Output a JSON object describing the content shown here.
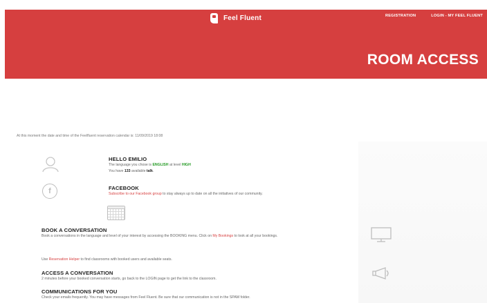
{
  "header": {
    "brand": "Feel Fluent",
    "nav": [
      "REGISTRATION",
      "LOGIN - MY FEEL FLUENT"
    ],
    "title": "ROOM ACCESS",
    "color": "#d63f3f"
  },
  "timestamp": "At this moment the date and time of the Feelfluent reservation calendar is: 11/09/2019 18:08",
  "hello": {
    "title": "HELLO EMILIO",
    "language_prefix": "The language you chose is ",
    "language": "ENGLISH",
    "level_mid": " at level ",
    "level": "HIGH",
    "talk_prefix": "You have ",
    "talk_count": "133",
    "talk_mid": " available ",
    "talk_suffix": "talk",
    "talk_end": "."
  },
  "facebook": {
    "title": "FACEBOOK",
    "link": "Subscribe to our Facebook group",
    "text": " to stay always up to date on all the initiatives of our community."
  },
  "booking": {
    "title": "BOOK A CONVERSATION",
    "text_before": "Book a conversations in the language and level of your interest by accessing the BOOKING menu. Click on ",
    "link": "My Bookings",
    "text_after": " to look at all your bookings.",
    "helper_link": "Reservation Helper",
    "helper_text": " to find classrooms with booked users and available seats.",
    "helper_prefix": "Use "
  },
  "access": {
    "title": "ACCESS A CONVERSATION",
    "text": "2 minutes before your booked conversation starts, go back to the LOGIN page to get the link to the classroom."
  },
  "communications": {
    "title": "COMMUNICATIONS FOR YOU",
    "text": "Check your emails frequently. You may have messages from Feel Fluent. Be sure that our communication is not in the SPAM folder."
  },
  "icons": [
    "user-icon",
    "facebook-icon",
    "calendar-icon",
    "monitor-icon",
    "megaphone-icon"
  ]
}
